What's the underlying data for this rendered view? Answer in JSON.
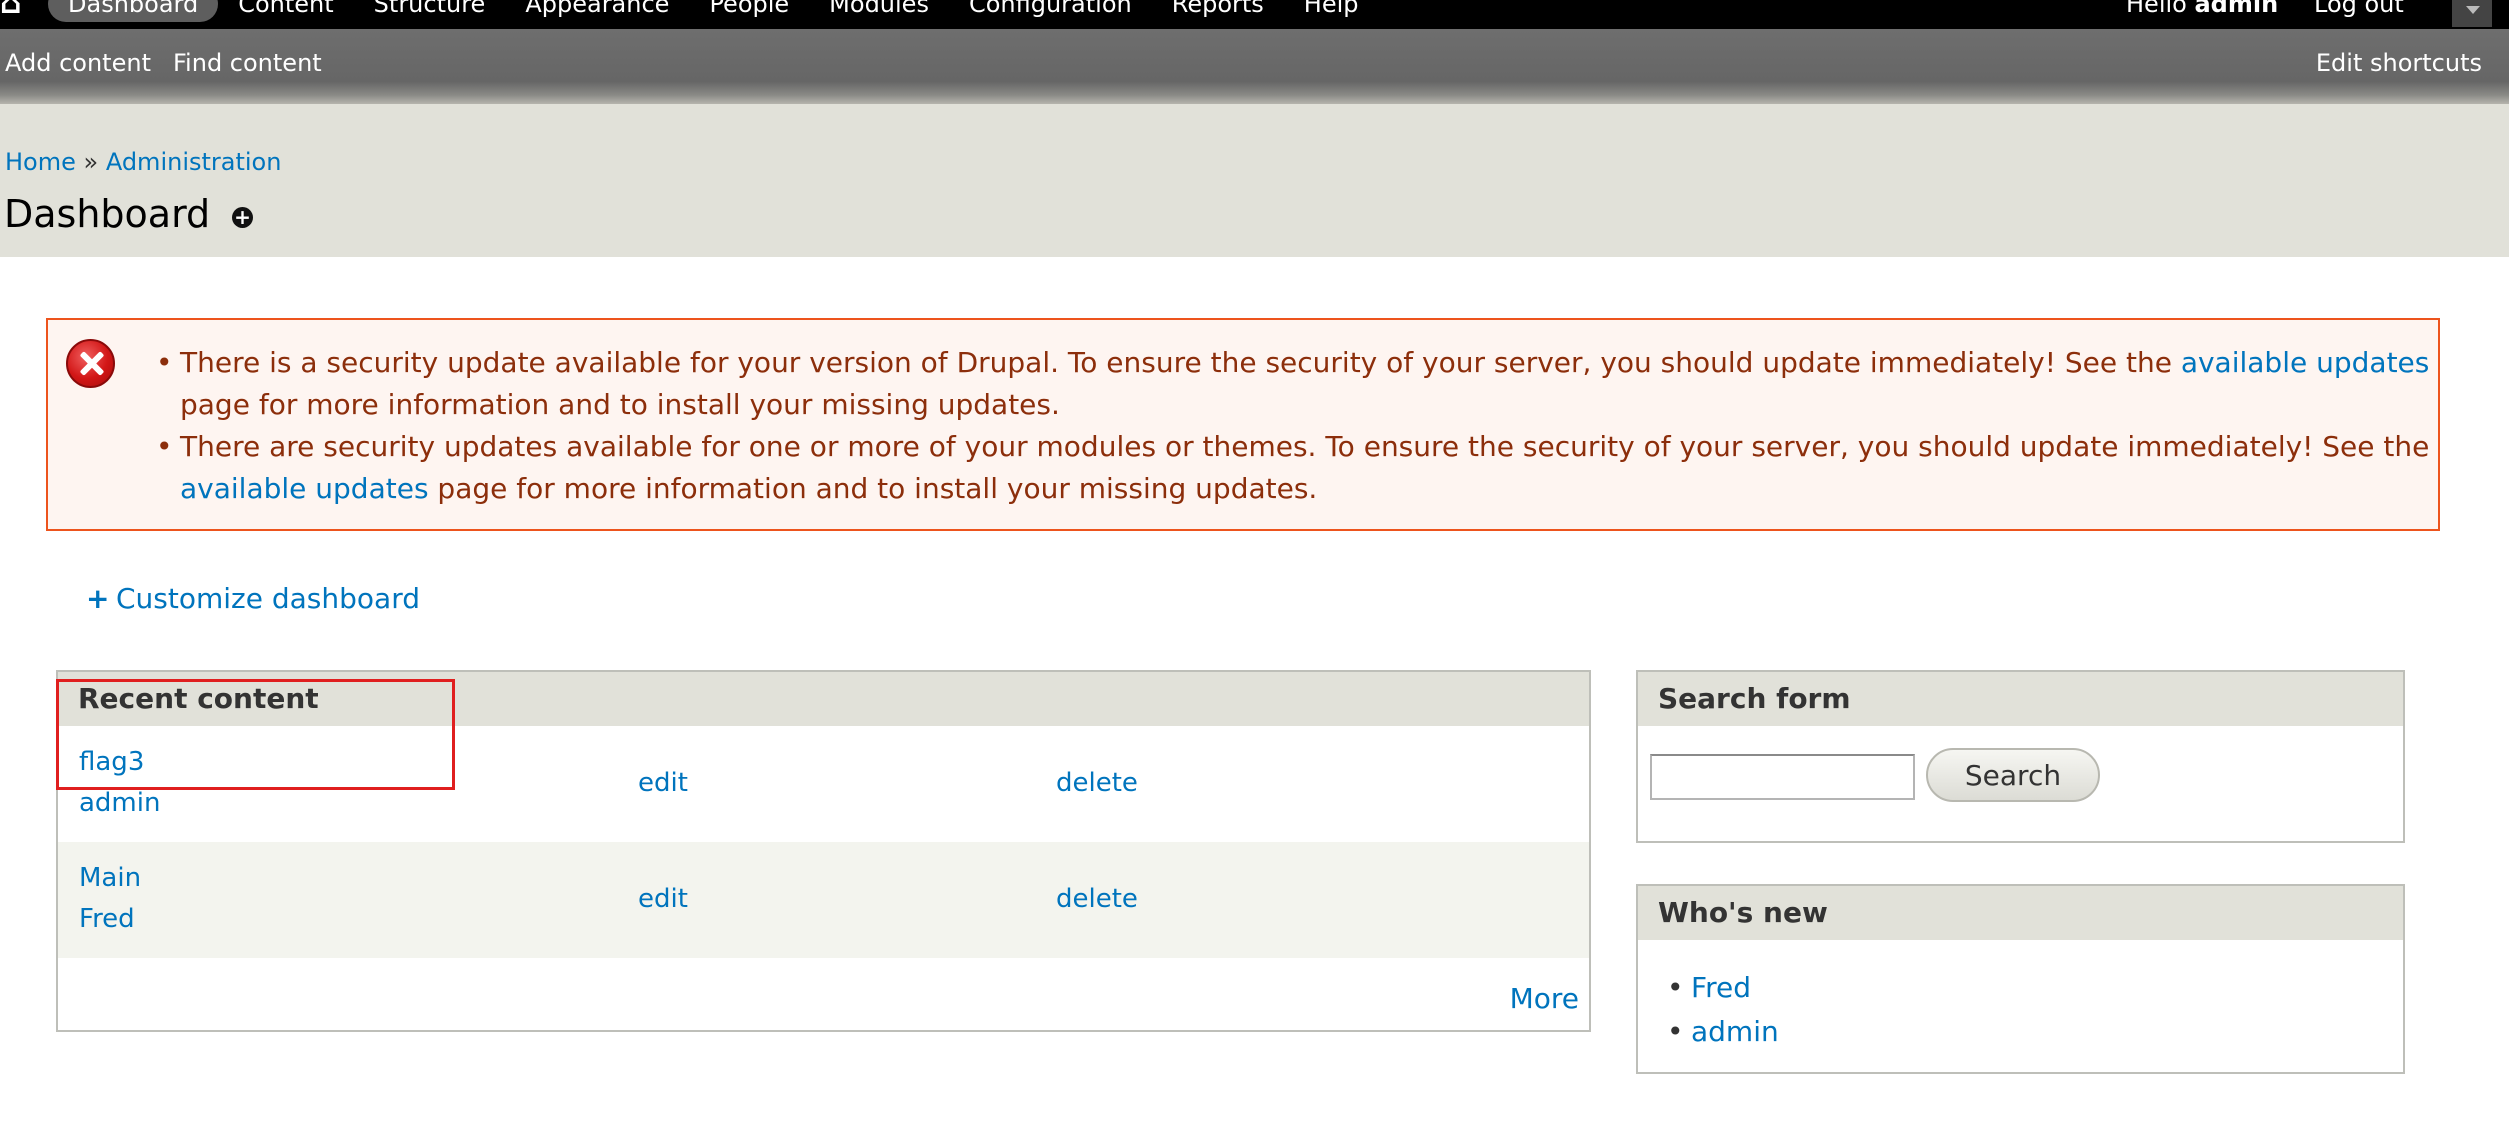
{
  "toolbar": {
    "home_icon": "home-icon",
    "menu": [
      "Dashboard",
      "Content",
      "Structure",
      "Appearance",
      "People",
      "Modules",
      "Configuration",
      "Reports",
      "Help"
    ],
    "hello_prefix": "Hello ",
    "username": "admin",
    "logout": "Log out",
    "toggle_icon": "toggle-arrow-icon"
  },
  "shortcuts": {
    "items": [
      "Add content",
      "Find content"
    ],
    "edit": "Edit shortcuts"
  },
  "breadcrumb": {
    "home": "Home",
    "separator": " » ",
    "admin": "Administration"
  },
  "page": {
    "title": "Dashboard",
    "add_icon": "add-shortcut-icon"
  },
  "messages": {
    "icon": "error-icon",
    "items": [
      {
        "before": "There is a security update available for your version of Drupal. To ensure the security of your server, you should update immediately! See the ",
        "link": "available updates",
        "after": " page for more information and to install your missing updates."
      },
      {
        "before": "There are security updates available for one or more of your modules or themes. To ensure the security of your server, you should update immediately! See the ",
        "link": "available updates",
        "after": " page for more information and to install your missing updates."
      }
    ]
  },
  "customize": {
    "plus": "+",
    "label": "Customize dashboard"
  },
  "recent_content": {
    "title": "Recent content",
    "rows": [
      {
        "title": "flag3",
        "author": "admin",
        "edit": "edit",
        "delete": "delete"
      },
      {
        "title": "Main",
        "author": "Fred",
        "edit": "edit",
        "delete": "delete"
      }
    ],
    "more": "More"
  },
  "search_form": {
    "title": "Search form",
    "input_value": "",
    "button": "Search"
  },
  "whos_new": {
    "title": "Who's new",
    "users": [
      "Fred",
      "admin"
    ]
  },
  "colors": {
    "link": "#0074bd",
    "error_text": "#8c2e0b",
    "error_border": "#ed541d",
    "error_bg": "#fef5f1",
    "highlight": "#e01f1f"
  }
}
